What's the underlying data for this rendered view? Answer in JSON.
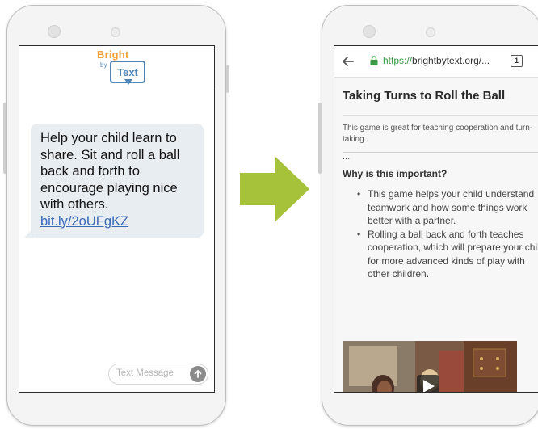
{
  "sms": {
    "logo_bright": "Bright",
    "logo_by": "by",
    "logo_text": "Text",
    "message_text": "Help your child learn to share. Sit and roll a ball back and forth to encourage playing nice with others.",
    "message_link": "bit.ly/2oUFgKZ",
    "input_placeholder": "Text Message",
    "send_icon": "send-arrow-icon"
  },
  "arrow": {
    "color": "#a6c23a",
    "icon": "right-arrow-icon"
  },
  "browser": {
    "url_scheme": "https://",
    "url_rest": "brightbytext.org/...",
    "tab_count": "1",
    "back_icon": "back-arrow-icon",
    "lock_icon": "lock-icon",
    "page_title": "Taking Turns to Roll the Ball",
    "page_description": "This game is great for teaching cooperation and turn-taking.",
    "ellipsis": "...",
    "section_heading": "Why is this important?",
    "bullets": [
      "This game helps your child understand teamwork and how some things work better with a partner.",
      "Rolling a ball back and forth teaches cooperation, which will prepare your child for more advanced kinds of play with other children."
    ],
    "video_play_icon": "play-icon"
  },
  "colors": {
    "logo_orange": "#f0a23a",
    "logo_blue": "#4f86b9",
    "link_blue": "#3a6ab8",
    "https_green": "#3a9a45",
    "arrow_green": "#a6c23a"
  }
}
